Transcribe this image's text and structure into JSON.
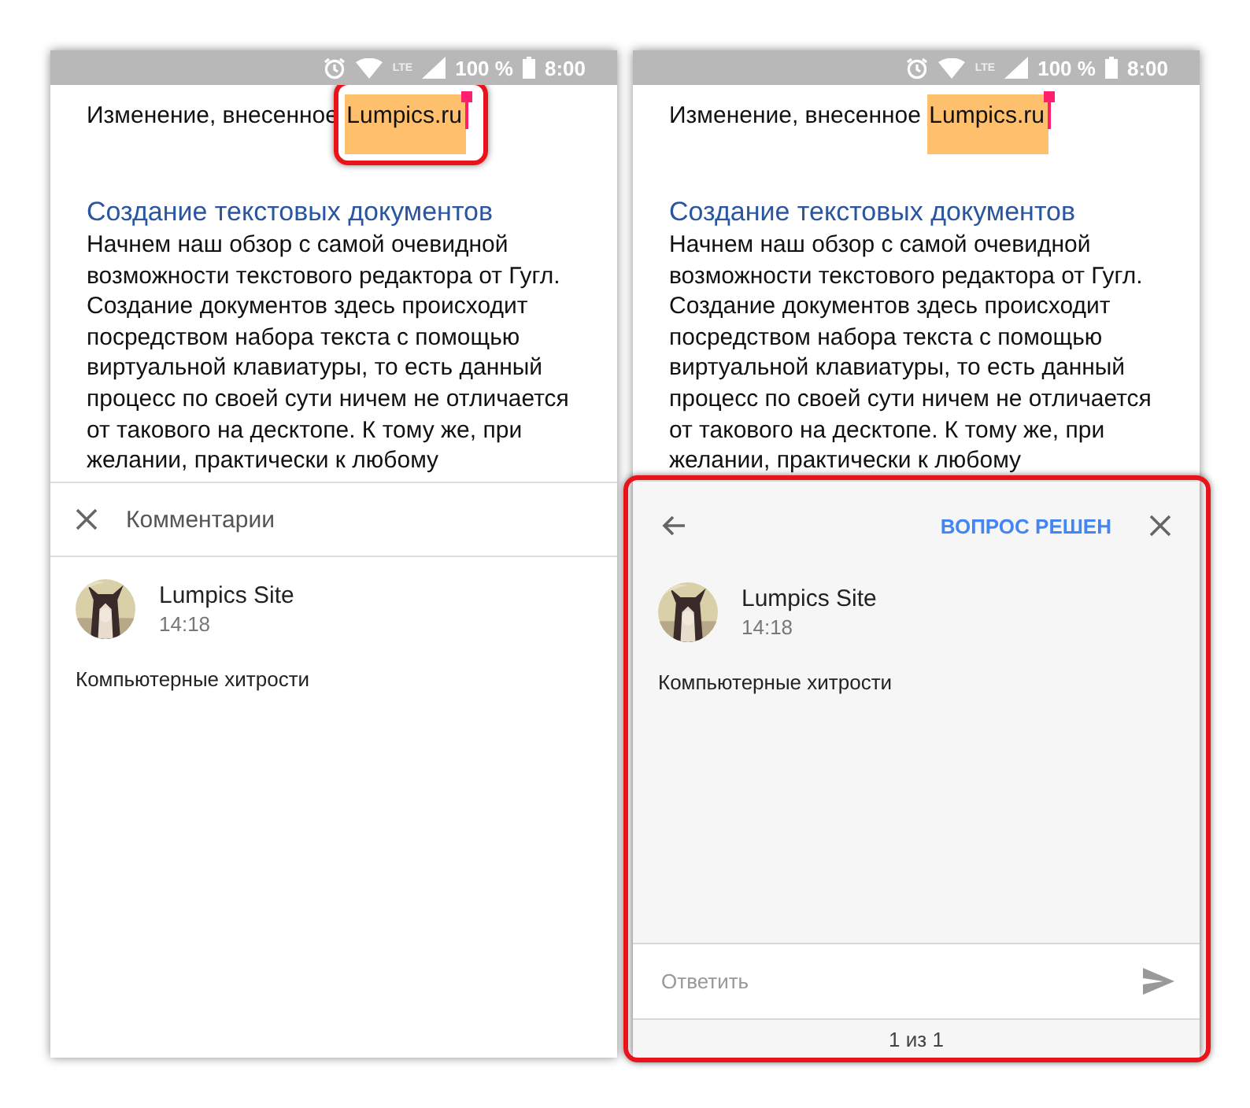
{
  "screens": [
    {
      "status_bar": {
        "lte": "LTE",
        "battery": "100 %",
        "time": "8:00"
      },
      "document": {
        "text_before": "Изменение, внесенное",
        "inserted_text": "Lumpics.ru",
        "inserted_highlighted": true,
        "heading": "Создание текстовых документов",
        "lines": [
          "Начнем наш обзор с самой очевидной",
          "возможности текстового редактора от Гугл.",
          "Создание документов здесь происходит",
          "посредством набора текста с помощью",
          "виртуальной клавиатуры, то есть данный",
          "процесс по своей сути ничем не отличается",
          "от такового на десктопе. К тому же, при",
          "желании, практически к любому"
        ]
      },
      "comments_panel": {
        "kind": "list",
        "highlighted": false,
        "title": "Комментарии",
        "comment": {
          "author": "Lumpics Site",
          "time": "14:18",
          "text": "Компьютерные хитрости"
        }
      }
    },
    {
      "status_bar": {
        "lte": "LTE",
        "battery": "100 %",
        "time": "8:00"
      },
      "document": {
        "text_before": "Изменение, внесенное",
        "inserted_text": "Lumpics.ru",
        "inserted_highlighted": false,
        "heading": "Создание текстовых документов",
        "lines": [
          "Начнем наш обзор с самой очевидной",
          "возможности текстового редактора от Гугл.",
          "Создание документов здесь происходит",
          "посредством набора текста с помощью",
          "виртуальной клавиатуры, то есть данный",
          "процесс по своей сути ничем не отличается",
          "от такового на десктопе. К тому же, при",
          "желании, практически к любому"
        ]
      },
      "comments_panel": {
        "kind": "thread",
        "highlighted": true,
        "resolve_button": "ВОПРОС РЕШЕН",
        "comment": {
          "author": "Lumpics Site",
          "time": "14:18",
          "text": "Компьютерные хитрости"
        },
        "reply": {
          "placeholder": "Ответить"
        },
        "pager": "1 из 1"
      }
    }
  ]
}
